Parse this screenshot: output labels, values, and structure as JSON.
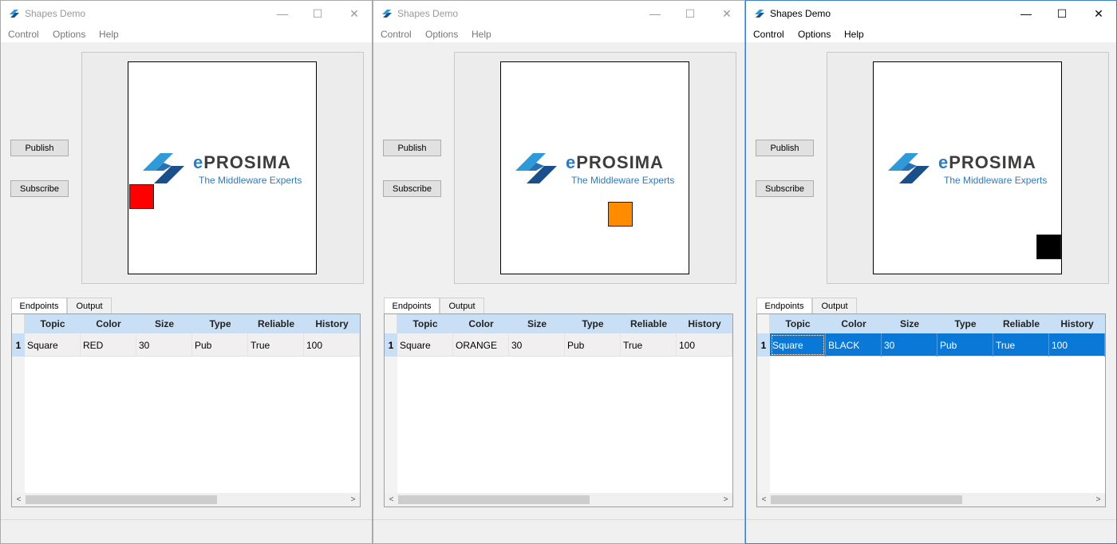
{
  "windows": [
    {
      "title": "Shapes Demo",
      "active": false,
      "menu": [
        "Control",
        "Options",
        "Help"
      ],
      "publish_label": "Publish",
      "subscribe_label": "Subscribe",
      "logo_word_e": "e",
      "logo_word_rest": "Prosima",
      "logo_tagline": "The Middleware Experts",
      "shape": {
        "name": "Square",
        "color": "#ff0000"
      },
      "tabs": [
        "Endpoints",
        "Output"
      ],
      "columns": [
        "Topic",
        "Color",
        "Size",
        "Type",
        "Reliable",
        "History"
      ],
      "rows": [
        {
          "num": "1",
          "cells": [
            "Square",
            "RED",
            "30",
            "Pub",
            "True",
            "100"
          ]
        }
      ],
      "row_selected": false
    },
    {
      "title": "Shapes Demo",
      "active": false,
      "menu": [
        "Control",
        "Options",
        "Help"
      ],
      "publish_label": "Publish",
      "subscribe_label": "Subscribe",
      "logo_word_e": "e",
      "logo_word_rest": "Prosima",
      "logo_tagline": "The Middleware Experts",
      "shape": {
        "name": "Square",
        "color": "#ff8c00"
      },
      "tabs": [
        "Endpoints",
        "Output"
      ],
      "columns": [
        "Topic",
        "Color",
        "Size",
        "Type",
        "Reliable",
        "History"
      ],
      "rows": [
        {
          "num": "1",
          "cells": [
            "Square",
            "ORANGE",
            "30",
            "Pub",
            "True",
            "100"
          ]
        }
      ],
      "row_selected": false
    },
    {
      "title": "Shapes Demo",
      "active": true,
      "menu": [
        "Control",
        "Options",
        "Help"
      ],
      "publish_label": "Publish",
      "subscribe_label": "Subscribe",
      "logo_word_e": "e",
      "logo_word_rest": "Prosima",
      "logo_tagline": "The Middleware Experts",
      "shape": {
        "name": "Square",
        "color": "#000000"
      },
      "tabs": [
        "Endpoints",
        "Output"
      ],
      "columns": [
        "Topic",
        "Color",
        "Size",
        "Type",
        "Reliable",
        "History"
      ],
      "rows": [
        {
          "num": "1",
          "cells": [
            "Square",
            "BLACK",
            "30",
            "Pub",
            "True",
            "100"
          ]
        }
      ],
      "row_selected": true
    }
  ],
  "window_controls": {
    "minimize": "—",
    "maximize": "☐",
    "close": "✕"
  },
  "scroll_arrows": {
    "left": "<",
    "right": ">"
  },
  "icons": {
    "app": "eprosima-logo-icon"
  },
  "accent_color": "#0a78d7",
  "header_color": "#c9dff5"
}
